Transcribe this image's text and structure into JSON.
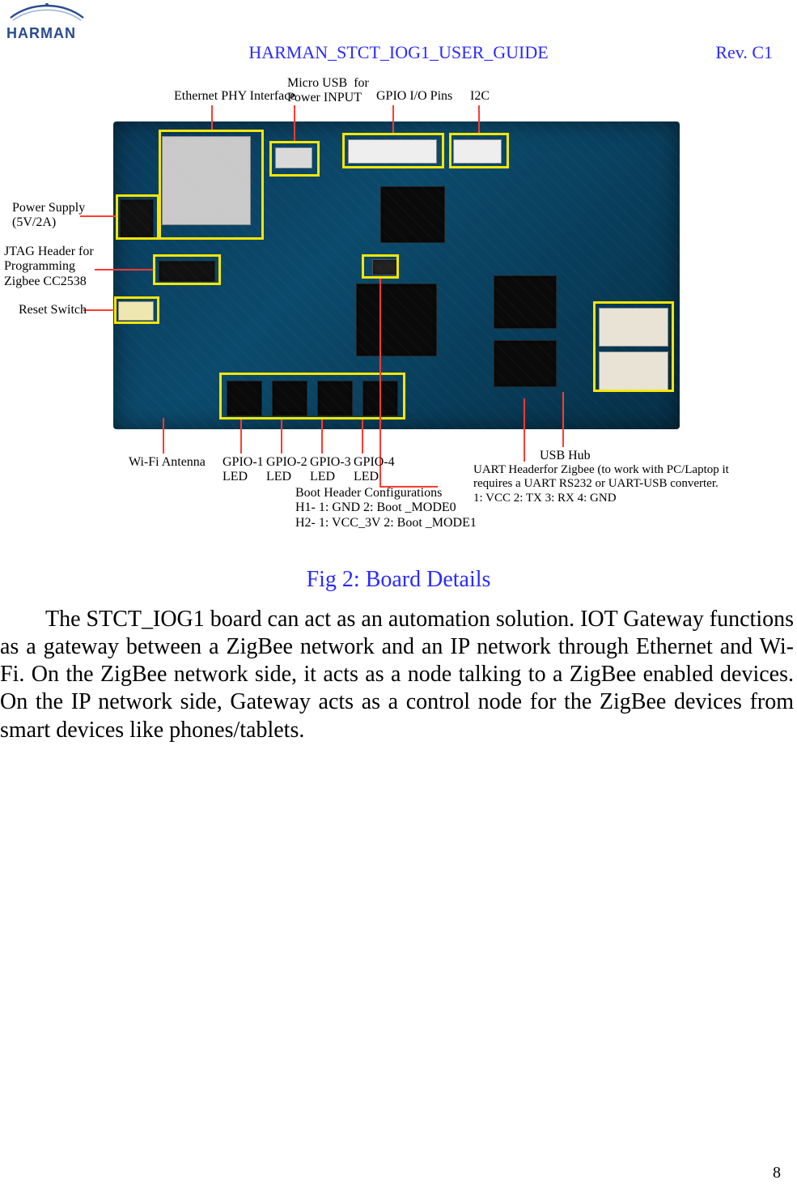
{
  "header": {
    "logo_text": "HARMAN",
    "title": "HARMAN_STCT_IOG1_USER_GUIDE",
    "revision": "Rev. C1"
  },
  "figure": {
    "caption": "Fig 2: Board Details",
    "labels": {
      "ethernet_phy": "Ethernet PHY Interface",
      "micro_usb": "Micro USB  for\nPower INPUT",
      "gpio_io": "GPIO I/O Pins",
      "i2c": "I2C",
      "power_supply": "Power Supply\n(5V/2A)",
      "jtag": "JTAG Header for\nProgramming\nZigbee CC2538",
      "reset": "Reset Switch",
      "wifi_antenna": "Wi-Fi Antenna",
      "gpio1": "GPIO-1\nLED",
      "gpio2": "GPIO-2\nLED",
      "gpio3": "GPIO-3\nLED",
      "gpio4": "GPIO-4\nLED",
      "boot_header": "Boot Header Configurations\nH1- 1: GND 2: Boot _MODE0\nH2- 1: VCC_3V 2: Boot _MODE1",
      "usb_hub": "USB Hub",
      "uart": "UART Headerfor Zigbee (to work with PC/Laptop it\nrequires a UART RS232 or UART-USB converter.\n1: VCC 2: TX 3: RX 4: GND"
    }
  },
  "body": {
    "p1": "The STCT_IOG1 board can act as an automation solution. IOT Gateway functions as a gateway between a ZigBee network and an IP network through Ethernet and Wi-Fi. On the ZigBee network side, it acts as a node talking to a ZigBee enabled devices. On the IP network side, Gateway acts as a control node for the ZigBee devices from smart devices like phones/tablets."
  },
  "page_number": "8"
}
